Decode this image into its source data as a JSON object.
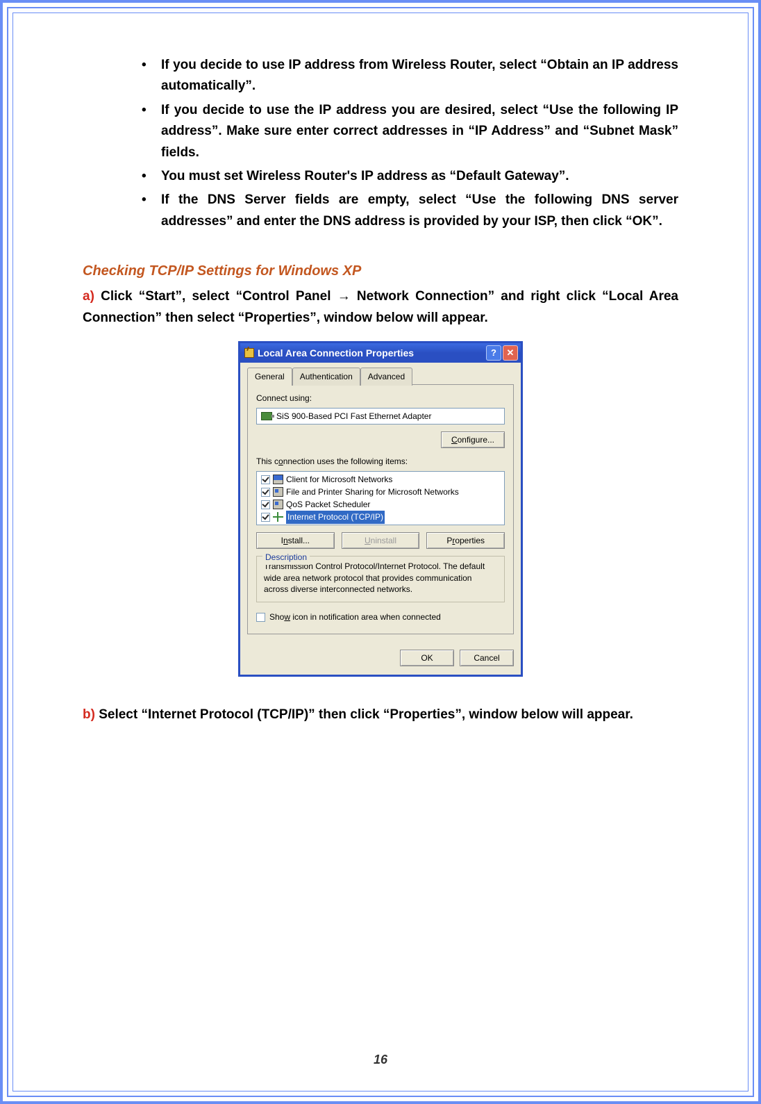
{
  "bullets": [
    "If you decide to use IP address from Wireless Router, select “Obtain an IP address automatically”.",
    "If you decide to use the IP address you are desired, select “Use the following IP address”. Make sure enter correct addresses in “IP Address” and “Subnet Mask” fields.",
    "You must set Wireless Router's IP address as “Default Gateway”.",
    "If the DNS Server fields are empty, select “Use the following DNS server addresses” and enter the DNS address is provided by your ISP, then click “OK”."
  ],
  "section_heading": "Checking TCP/IP Settings for Windows XP",
  "step_a": {
    "label": "a)",
    "text": " Click “Start”, select “Control Panel → Network Connection” and right click “Local Area Connection” then select “Properties”, window below will appear."
  },
  "step_b": {
    "label": "b)",
    "text": " Select “Internet Protocol (TCP/IP)” then click “Properties”, window below will appear."
  },
  "page_number": "16",
  "dialog": {
    "title": "Local Area Connection Properties",
    "help_btn": "?",
    "close_btn": "✕",
    "tabs": {
      "general": "General",
      "auth": "Authentication",
      "adv": "Advanced"
    },
    "connect_using_label": "Connect using:",
    "adapter": "SiS 900-Based PCI Fast Ethernet Adapter",
    "configure_btn": {
      "pre": "",
      "u": "C",
      "post": "onfigure..."
    },
    "items_label": {
      "pre": "This c",
      "u": "o",
      "post": "nnection uses the following items:"
    },
    "items": [
      {
        "text": "Client for Microsoft Networks",
        "checked": true,
        "icon": "monitor"
      },
      {
        "text": "File and Printer Sharing for Microsoft Networks",
        "checked": true,
        "icon": "share"
      },
      {
        "text": "QoS Packet Scheduler",
        "checked": true,
        "icon": "qos"
      },
      {
        "text": "Internet Protocol (TCP/IP)",
        "checked": true,
        "icon": "net",
        "selected": true
      }
    ],
    "install_btn": {
      "pre": "I",
      "u": "n",
      "post": "stall..."
    },
    "uninstall_btn": {
      "pre": "",
      "u": "U",
      "post": "ninstall"
    },
    "properties_btn": {
      "pre": "P",
      "u": "r",
      "post": "operties"
    },
    "description_legend": "Description",
    "description_body": "Transmission Control Protocol/Internet Protocol. The default wide area network protocol that provides communication across diverse interconnected networks.",
    "show_icon": {
      "pre": "Sho",
      "u": "w",
      "post": " icon in notification area when connected",
      "checked": false
    },
    "ok_btn": "OK",
    "cancel_btn": "Cancel"
  }
}
